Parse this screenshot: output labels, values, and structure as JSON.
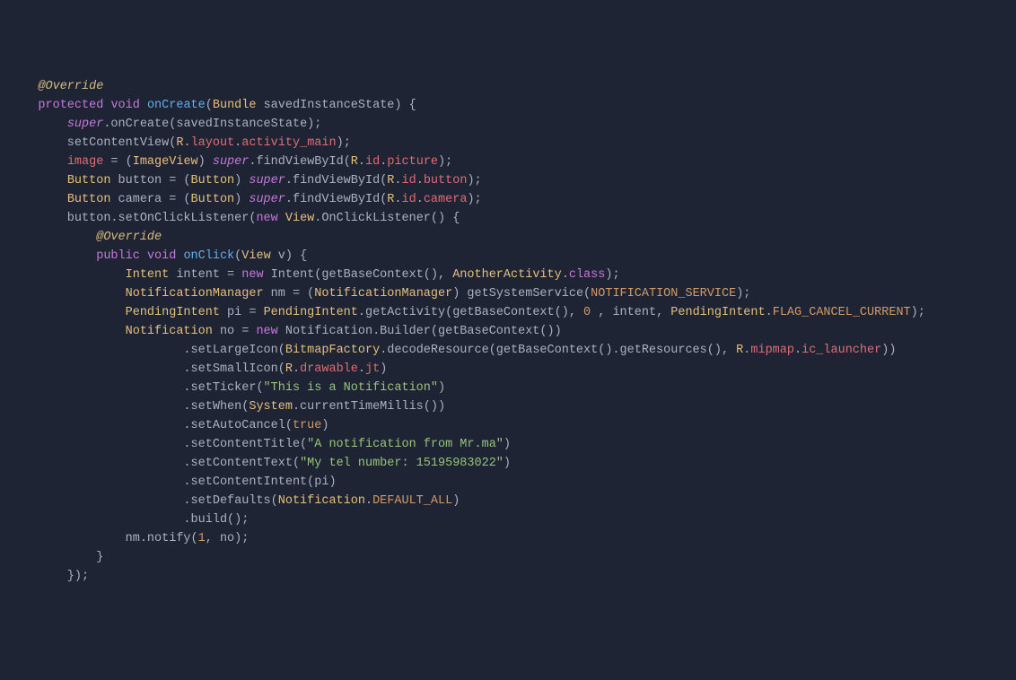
{
  "lines": [
    [
      {
        "cls": "c-punc",
        "text": "    "
      },
      {
        "cls": "c-anno",
        "text": "@Override"
      }
    ],
    [
      {
        "cls": "c-punc",
        "text": "    "
      },
      {
        "cls": "c-kw",
        "text": "protected"
      },
      {
        "cls": "c-punc",
        "text": " "
      },
      {
        "cls": "c-kw",
        "text": "void"
      },
      {
        "cls": "c-punc",
        "text": " "
      },
      {
        "cls": "c-fn",
        "text": "onCreate"
      },
      {
        "cls": "c-punc",
        "text": "("
      },
      {
        "cls": "c-type",
        "text": "Bundle"
      },
      {
        "cls": "c-punc",
        "text": " savedInstanceState) {"
      }
    ],
    [
      {
        "cls": "c-punc",
        "text": "        "
      },
      {
        "cls": "c-super",
        "text": "super"
      },
      {
        "cls": "c-punc",
        "text": ".onCreate(savedInstanceState);"
      }
    ],
    [
      {
        "cls": "c-punc",
        "text": "        setContentView("
      },
      {
        "cls": "c-type",
        "text": "R"
      },
      {
        "cls": "c-punc",
        "text": "."
      },
      {
        "cls": "c-prop",
        "text": "layout"
      },
      {
        "cls": "c-punc",
        "text": "."
      },
      {
        "cls": "c-prop",
        "text": "activity_main"
      },
      {
        "cls": "c-punc",
        "text": ");"
      }
    ],
    [
      {
        "cls": "c-punc",
        "text": "        "
      },
      {
        "cls": "c-prop",
        "text": "image"
      },
      {
        "cls": "c-punc",
        "text": " = ("
      },
      {
        "cls": "c-type",
        "text": "ImageView"
      },
      {
        "cls": "c-punc",
        "text": ") "
      },
      {
        "cls": "c-super",
        "text": "super"
      },
      {
        "cls": "c-punc",
        "text": ".findViewById("
      },
      {
        "cls": "c-type",
        "text": "R"
      },
      {
        "cls": "c-punc",
        "text": "."
      },
      {
        "cls": "c-prop",
        "text": "id"
      },
      {
        "cls": "c-punc",
        "text": "."
      },
      {
        "cls": "c-prop",
        "text": "picture"
      },
      {
        "cls": "c-punc",
        "text": ");"
      }
    ],
    [
      {
        "cls": "c-punc",
        "text": "        "
      },
      {
        "cls": "c-type",
        "text": "Button"
      },
      {
        "cls": "c-punc",
        "text": " button = ("
      },
      {
        "cls": "c-type",
        "text": "Button"
      },
      {
        "cls": "c-punc",
        "text": ") "
      },
      {
        "cls": "c-super",
        "text": "super"
      },
      {
        "cls": "c-punc",
        "text": ".findViewById("
      },
      {
        "cls": "c-type",
        "text": "R"
      },
      {
        "cls": "c-punc",
        "text": "."
      },
      {
        "cls": "c-prop",
        "text": "id"
      },
      {
        "cls": "c-punc",
        "text": "."
      },
      {
        "cls": "c-prop",
        "text": "button"
      },
      {
        "cls": "c-punc",
        "text": ");"
      }
    ],
    [
      {
        "cls": "c-punc",
        "text": "        "
      },
      {
        "cls": "c-type",
        "text": "Button"
      },
      {
        "cls": "c-punc",
        "text": " camera = ("
      },
      {
        "cls": "c-type",
        "text": "Button"
      },
      {
        "cls": "c-punc",
        "text": ") "
      },
      {
        "cls": "c-super",
        "text": "super"
      },
      {
        "cls": "c-punc",
        "text": ".findViewById("
      },
      {
        "cls": "c-type",
        "text": "R"
      },
      {
        "cls": "c-punc",
        "text": "."
      },
      {
        "cls": "c-prop",
        "text": "id"
      },
      {
        "cls": "c-punc",
        "text": "."
      },
      {
        "cls": "c-prop",
        "text": "camera"
      },
      {
        "cls": "c-punc",
        "text": ");"
      }
    ],
    [
      {
        "cls": "c-punc",
        "text": "        button.setOnClickListener("
      },
      {
        "cls": "c-kw",
        "text": "new"
      },
      {
        "cls": "c-punc",
        "text": " "
      },
      {
        "cls": "c-type",
        "text": "View"
      },
      {
        "cls": "c-punc",
        "text": ".OnClickListener() {"
      }
    ],
    [
      {
        "cls": "c-punc",
        "text": "            "
      },
      {
        "cls": "c-anno",
        "text": "@Override"
      }
    ],
    [
      {
        "cls": "c-punc",
        "text": "            "
      },
      {
        "cls": "c-kw",
        "text": "public"
      },
      {
        "cls": "c-punc",
        "text": " "
      },
      {
        "cls": "c-kw",
        "text": "void"
      },
      {
        "cls": "c-punc",
        "text": " "
      },
      {
        "cls": "c-fn",
        "text": "onClick"
      },
      {
        "cls": "c-punc",
        "text": "("
      },
      {
        "cls": "c-type",
        "text": "View"
      },
      {
        "cls": "c-punc",
        "text": " v) {"
      }
    ],
    [
      {
        "cls": "c-punc",
        "text": "                "
      },
      {
        "cls": "c-type",
        "text": "Intent"
      },
      {
        "cls": "c-punc",
        "text": " intent = "
      },
      {
        "cls": "c-kw",
        "text": "new"
      },
      {
        "cls": "c-punc",
        "text": " Intent(getBaseContext(), "
      },
      {
        "cls": "c-type",
        "text": "AnotherActivity"
      },
      {
        "cls": "c-punc",
        "text": "."
      },
      {
        "cls": "c-cls",
        "text": "class"
      },
      {
        "cls": "c-punc",
        "text": ");"
      }
    ],
    [
      {
        "cls": "c-punc",
        "text": "                "
      },
      {
        "cls": "c-type",
        "text": "NotificationManager"
      },
      {
        "cls": "c-punc",
        "text": " nm = ("
      },
      {
        "cls": "c-type",
        "text": "NotificationManager"
      },
      {
        "cls": "c-punc",
        "text": ") getSystemService("
      },
      {
        "cls": "c-const",
        "text": "NOTIFICATION_SERVICE"
      },
      {
        "cls": "c-punc",
        "text": ");"
      }
    ],
    [
      {
        "cls": "c-punc",
        "text": "                "
      },
      {
        "cls": "c-type",
        "text": "PendingIntent"
      },
      {
        "cls": "c-punc",
        "text": " pi = "
      },
      {
        "cls": "c-type",
        "text": "PendingIntent"
      },
      {
        "cls": "c-punc",
        "text": ".getActivity(getBaseContext(), "
      },
      {
        "cls": "c-num",
        "text": "0"
      },
      {
        "cls": "c-punc",
        "text": " , intent, "
      },
      {
        "cls": "c-type",
        "text": "PendingIntent"
      },
      {
        "cls": "c-punc",
        "text": "."
      },
      {
        "cls": "c-const",
        "text": "FLAG_CANCEL_CURRENT"
      },
      {
        "cls": "c-punc",
        "text": ");"
      }
    ],
    [
      {
        "cls": "c-punc",
        "text": "                "
      },
      {
        "cls": "c-type",
        "text": "Notification"
      },
      {
        "cls": "c-punc",
        "text": " no = "
      },
      {
        "cls": "c-kw",
        "text": "new"
      },
      {
        "cls": "c-punc",
        "text": " Notification.Builder(getBaseContext())"
      }
    ],
    [
      {
        "cls": "c-punc",
        "text": "                        .setLargeIcon("
      },
      {
        "cls": "c-type",
        "text": "BitmapFactory"
      },
      {
        "cls": "c-punc",
        "text": ".decodeResource(getBaseContext().getResources(), "
      },
      {
        "cls": "c-type",
        "text": "R"
      },
      {
        "cls": "c-punc",
        "text": "."
      },
      {
        "cls": "c-prop",
        "text": "mipmap"
      },
      {
        "cls": "c-punc",
        "text": "."
      },
      {
        "cls": "c-prop",
        "text": "ic_launcher"
      },
      {
        "cls": "c-punc",
        "text": "))"
      }
    ],
    [
      {
        "cls": "c-punc",
        "text": "                        .setSmallIcon("
      },
      {
        "cls": "c-type",
        "text": "R"
      },
      {
        "cls": "c-punc",
        "text": "."
      },
      {
        "cls": "c-prop",
        "text": "drawable"
      },
      {
        "cls": "c-punc",
        "text": "."
      },
      {
        "cls": "c-prop",
        "text": "jt"
      },
      {
        "cls": "c-punc",
        "text": ")"
      }
    ],
    [
      {
        "cls": "c-punc",
        "text": "                        .setTicker("
      },
      {
        "cls": "c-str",
        "text": "\"This is a Notification\""
      },
      {
        "cls": "c-punc",
        "text": ")"
      }
    ],
    [
      {
        "cls": "c-punc",
        "text": "                        .setWhen("
      },
      {
        "cls": "c-type",
        "text": "System"
      },
      {
        "cls": "c-punc",
        "text": ".currentTimeMillis())"
      }
    ],
    [
      {
        "cls": "c-punc",
        "text": "                        .setAutoCancel("
      },
      {
        "cls": "c-bool",
        "text": "true"
      },
      {
        "cls": "c-punc",
        "text": ")"
      }
    ],
    [
      {
        "cls": "c-punc",
        "text": "                        .setContentTitle("
      },
      {
        "cls": "c-str",
        "text": "\"A notification from Mr.ma\""
      },
      {
        "cls": "c-punc",
        "text": ")"
      }
    ],
    [
      {
        "cls": "c-punc",
        "text": "                        .setContentText("
      },
      {
        "cls": "c-str",
        "text": "\"My tel number: 15195983022\""
      },
      {
        "cls": "c-punc",
        "text": ")"
      }
    ],
    [
      {
        "cls": "c-punc",
        "text": "                        .setContentIntent(pi)"
      }
    ],
    [
      {
        "cls": "c-punc",
        "text": "                        .setDefaults("
      },
      {
        "cls": "c-type",
        "text": "Notification"
      },
      {
        "cls": "c-punc",
        "text": "."
      },
      {
        "cls": "c-const",
        "text": "DEFAULT_ALL"
      },
      {
        "cls": "c-punc",
        "text": ")"
      }
    ],
    [
      {
        "cls": "c-punc",
        "text": "                        .build();"
      }
    ],
    [
      {
        "cls": "c-punc",
        "text": "                nm.notify("
      },
      {
        "cls": "c-num",
        "text": "1"
      },
      {
        "cls": "c-punc",
        "text": ", no);"
      }
    ],
    [
      {
        "cls": "c-punc",
        "text": "            }"
      }
    ],
    [
      {
        "cls": "c-punc",
        "text": "        });"
      }
    ]
  ]
}
